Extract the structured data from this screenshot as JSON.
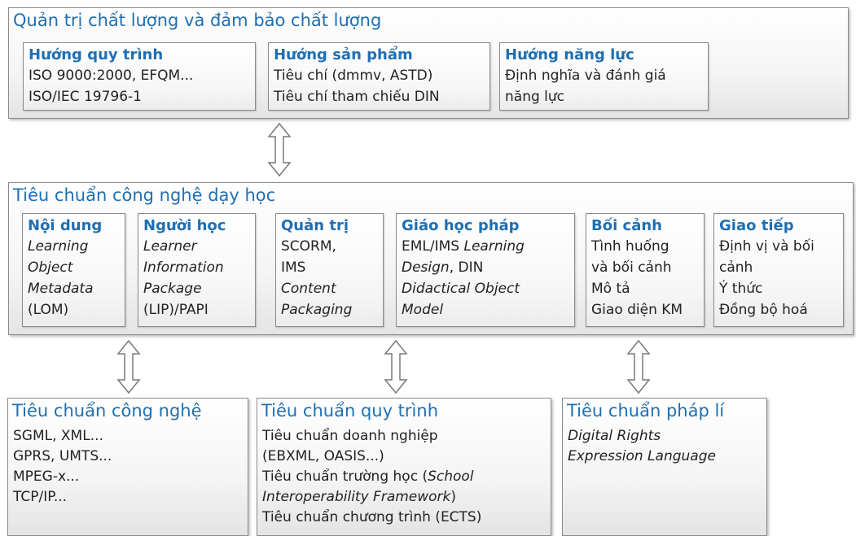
{
  "top": {
    "title": "Quản trị chất lượng và đảm bảo chất lượng",
    "boxes": [
      {
        "title": "Hướng quy trình",
        "lines": [
          "ISO 9000:2000, EFQM...",
          "ISO/IEC 19796-1"
        ]
      },
      {
        "title": "Hướng sản phẩm",
        "lines": [
          "Tiêu chí (dmmv, ASTD)",
          "Tiêu chí tham chiếu DIN"
        ]
      },
      {
        "title": "Hướng năng lực",
        "lines": [
          "Định nghĩa và đánh giá",
          "năng lực"
        ]
      }
    ]
  },
  "middle": {
    "title": "Tiêu chuẩn công nghệ dạy học",
    "boxes": [
      {
        "title": "Nội dung",
        "l1": "Learning",
        "l2": "Object",
        "l3": "Metadata",
        "l4": "(LOM)"
      },
      {
        "title": "Người học",
        "l1": "Learner",
        "l2": "Information",
        "l3": "Package",
        "l4": "(LIP)/PAPI"
      },
      {
        "title": "Quản trị",
        "l1": "SCORM,",
        "l2": "IMS",
        "l3": "Content",
        "l4": "Packaging"
      },
      {
        "title": "Giáo học pháp",
        "l1a": "EML/IMS ",
        "l1b": "Learning",
        "l2a": "Design",
        "l2b": ", DIN",
        "l3": "Didactical Object",
        "l4": "Model"
      },
      {
        "title": "Bối cảnh",
        "l1": "Tình huống",
        "l2": "và bối cảnh",
        "l3": "Mô tả",
        "l4": "Giao diện KM"
      },
      {
        "title": "Giao tiếp",
        "l1": "Định vị và bối",
        "l2": "cảnh",
        "l3": "Ý thức",
        "l4": "Đồng bộ hoá"
      }
    ]
  },
  "bottom": [
    {
      "title": "Tiêu chuẩn công nghệ",
      "lines": [
        "SGML, XML...",
        "GPRS, UMTS...",
        "MPEG-x...",
        "TCP/IP..."
      ]
    },
    {
      "title": "Tiêu chuẩn quy trình",
      "l1": "Tiêu chuẩn doanh nghiệp",
      "l2": "(EBXML, OASIS...)",
      "l3a": "Tiêu chuẩn trường học (",
      "l3b": "School",
      "l4a": "Interoperability Framework",
      "l4b": ")",
      "l5": "Tiêu chuẩn chương trình (ECTS)"
    },
    {
      "title": "Tiêu chuẩn pháp lí",
      "l1": "Digital Rights",
      "l2": "Expression Language"
    }
  ],
  "colors": {
    "accent": "#1f6fb2",
    "border": "#8a8a8a"
  },
  "icons": [
    "double-arrow-icon"
  ]
}
